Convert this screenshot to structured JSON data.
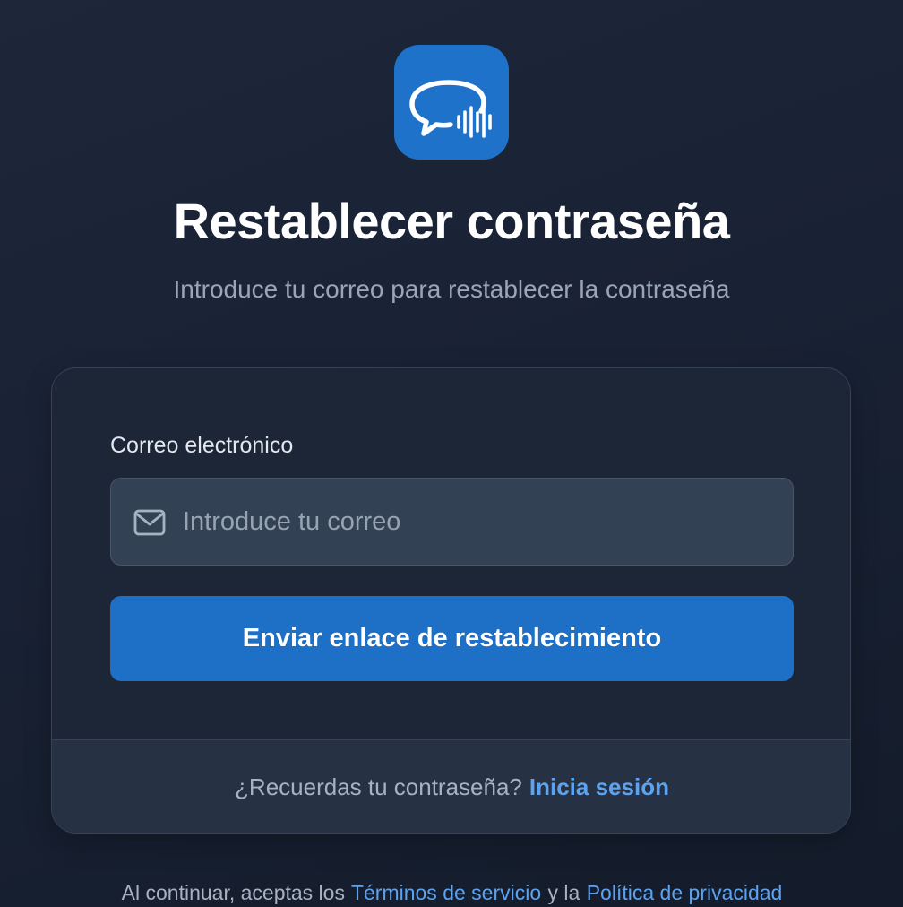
{
  "app": {
    "logo_icon": "chat-bubble-waveform-icon",
    "accent_color": "#1f72c9"
  },
  "header": {
    "title": "Restablecer contraseña",
    "subtitle": "Introduce tu correo para restablecer la contraseña"
  },
  "form": {
    "email_label": "Correo electrónico",
    "email_placeholder": "Introduce tu correo",
    "email_value": "",
    "email_icon": "mail-icon",
    "submit_label": "Enviar enlace de restablecimiento"
  },
  "card_footer": {
    "prompt": "¿Recuerdas tu contraseña?",
    "signin_link": "Inicia sesión"
  },
  "legal": {
    "prefix": "Al continuar, aceptas los",
    "terms_link": "Términos de servicio",
    "connector": "y la",
    "privacy_link": "Política de privacidad"
  }
}
